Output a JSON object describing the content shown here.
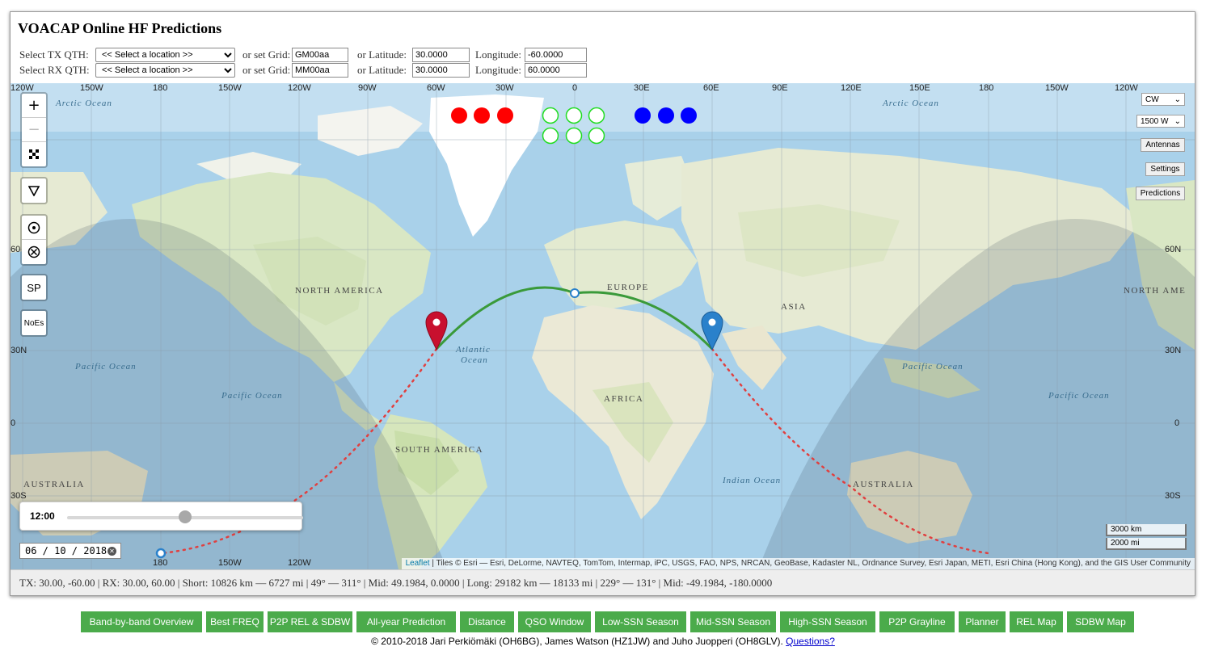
{
  "title": "VOACAP Online HF Predictions",
  "tx_row": {
    "label": "Select TX QTH:",
    "select_value": "<< Select a location >>",
    "grid_label": "or set Grid:",
    "grid_value": "GM00aa",
    "lat_label": "or  Latitude:",
    "lat_value": "30.0000",
    "lon_label": "Longitude:",
    "lon_value": "-60.0000"
  },
  "rx_row": {
    "label": "Select RX QTH:",
    "select_value": "<< Select a location >>",
    "grid_label": "or set Grid:",
    "grid_value": "MM00aa",
    "lat_label": "or  Latitude:",
    "lat_value": "30.0000",
    "lon_label": "Longitude:",
    "lon_value": "60.0000"
  },
  "map": {
    "lon_labels_top": [
      "120W",
      "150W",
      "180",
      "150W",
      "120W",
      "90W",
      "60W",
      "30W",
      "0",
      "30E",
      "60E",
      "90E",
      "120E",
      "150E",
      "180",
      "150W",
      "120W"
    ],
    "lat_labels": [
      "60",
      "30N",
      "0",
      "30S"
    ],
    "lat_labels_right": [
      "60N",
      "30N",
      "0",
      "30S"
    ],
    "lon_labels_bottom": [
      "180",
      "150W",
      "120W"
    ],
    "region_labels": [
      "NORTH AMERICA",
      "SOUTH AMERICA",
      "EUROPE",
      "AFRICA",
      "ASIA",
      "AUSTRALIA",
      "AUSTRALIA",
      "NORTH AME"
    ],
    "ocean_labels": [
      "Arctic Ocean",
      "Arctic Ocean",
      "Pacific Ocean",
      "Pacific Ocean",
      "Atlantic",
      "Ocean",
      "Indian Ocean",
      "Pacific Ocean",
      "Pacific Ocean"
    ],
    "controls": {
      "zoom_in": "+",
      "zoom_out": "−",
      "sp": "SP",
      "noes": "NoEs"
    },
    "right_controls": {
      "mode": "CW",
      "power": "1500 W",
      "antennas": "Antennas",
      "settings": "Settings",
      "predictions": "Predictions"
    },
    "time": "12:00",
    "time_fraction": 0.5,
    "date": "06 / 10 / 2018",
    "scale_km": "3000 km",
    "scale_mi": "2000 mi",
    "attribution_link": "Leaflet",
    "attribution_text": " | Tiles © Esri — Esri, DeLorme, NAVTEQ, TomTom, Intermap, iPC, USGS, FAO, NPS, NRCAN, GeoBase, Kadaster NL, Ordnance Survey, Esri Japan, METI, Esri China (Hong Kong), and the GIS User Community",
    "indicator_colors": {
      "red": "#ff0000",
      "green_outline": "#22dd22",
      "blue": "#0000ff"
    }
  },
  "status_bar": "TX: 30.00, -60.00  |  RX: 30.00, 60.00  |  Short: 10826 km — 6727 mi  |   49° — 311°  |  Mid: 49.1984, 0.0000  |  Long: 29182 km — 18133 mi  |   229° — 131°  |  Mid: -49.1984, -180.0000",
  "nav_buttons": [
    "Band-by-band Overview",
    "Best FREQ",
    "P2P REL & SDBW",
    "All-year Prediction",
    "Distance",
    "QSO Window",
    "Low-SSN Season",
    "Mid-SSN Season",
    "High-SSN Season",
    "P2P Grayline",
    "Planner",
    "REL Map",
    "SDBW Map"
  ],
  "footer": {
    "text": "© 2010-2018 Jari Perkiömäki (OH6BG), James Watson (HZ1JW) and Juho Juopperi (OH8GLV).",
    "link": "Questions?"
  },
  "colors": {
    "nav_green": "#4bab4b",
    "short_path": "#3a9a3a",
    "long_path": "#e04040",
    "tx_marker": "#c8102e",
    "rx_marker": "#2a81cb"
  }
}
